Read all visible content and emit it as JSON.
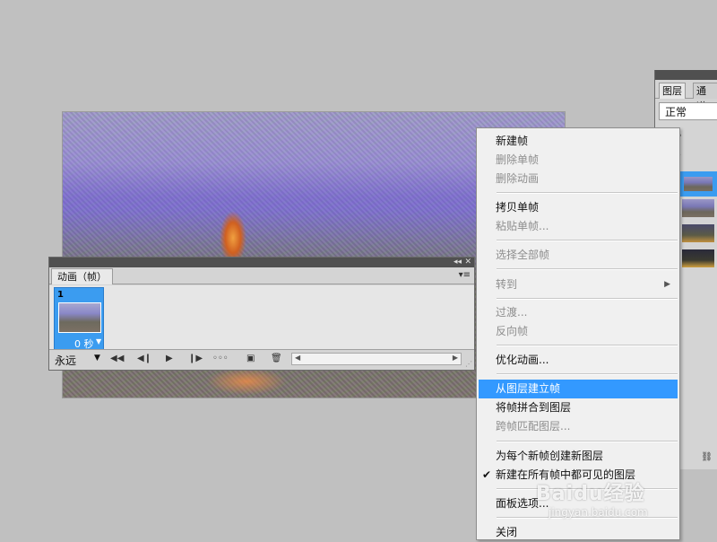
{
  "animation_panel": {
    "tab_label": "动画（帧）",
    "frames": [
      {
        "number": "1",
        "delay": "0 秒"
      }
    ],
    "loop_value": "永远",
    "icons": {
      "collapse": "double-chevron-left-icon",
      "close": "close-icon",
      "panel_menu": "panel-menu-icon",
      "first_frame": "first-frame-icon",
      "previous_frame": "previous-frame-icon",
      "play": "play-icon",
      "next_frame": "next-frame-icon",
      "tween": "tween-icon",
      "duplicate_frame": "duplicate-frame-icon",
      "delete_frame": "trash-icon"
    }
  },
  "layers_panel": {
    "tabs": [
      "图层",
      "通道"
    ],
    "blend_mode": "正常"
  },
  "context_menu": {
    "items": [
      {
        "label": "新建帧",
        "enabled": true
      },
      {
        "label": "删除单帧",
        "enabled": false
      },
      {
        "label": "删除动画",
        "enabled": false
      },
      {
        "label": "拷贝单帧",
        "enabled": true
      },
      {
        "label": "粘贴单帧...",
        "enabled": false
      },
      {
        "label": "选择全部帧",
        "enabled": false
      },
      {
        "label": "转到",
        "enabled": false,
        "submenu": true
      },
      {
        "label": "过渡...",
        "enabled": false
      },
      {
        "label": "反向帧",
        "enabled": false
      },
      {
        "label": "优化动画...",
        "enabled": true
      },
      {
        "label": "从图层建立帧",
        "enabled": true,
        "highlighted": true
      },
      {
        "label": "将帧拼合到图层",
        "enabled": true
      },
      {
        "label": "跨帧匹配图层...",
        "enabled": false
      },
      {
        "label": "为每个新帧创建新图层",
        "enabled": true
      },
      {
        "label": "新建在所有帧中都可见的图层",
        "enabled": true,
        "checked": true
      },
      {
        "label": "面板选项...",
        "enabled": true
      },
      {
        "label": "关闭",
        "enabled": true
      }
    ]
  },
  "watermark": {
    "brand": "Baidu经验",
    "url": "jingyan.baidu.com"
  }
}
